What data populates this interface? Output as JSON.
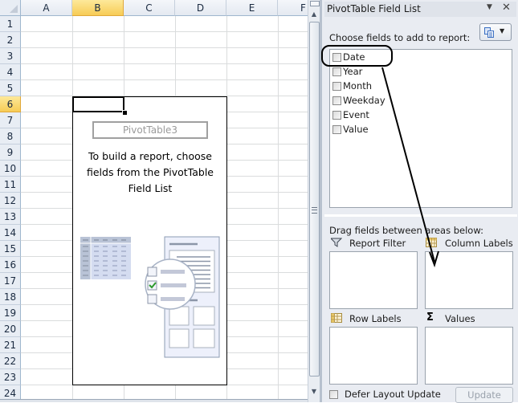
{
  "spreadsheet": {
    "columns": [
      "A",
      "B",
      "C",
      "D",
      "E",
      "F"
    ],
    "selected_column": "B",
    "rows": [
      "1",
      "2",
      "3",
      "4",
      "5",
      "6",
      "7",
      "8",
      "9",
      "10",
      "11",
      "12",
      "13",
      "14",
      "15",
      "16",
      "17",
      "18",
      "19",
      "20",
      "21",
      "22",
      "23",
      "24"
    ],
    "selected_row": "6",
    "active_cell": "B6",
    "pivot_placeholder": {
      "name": "PivotTable3",
      "message": "To build a report, choose fields from the PivotTable Field List"
    }
  },
  "pane": {
    "title": "PivotTable Field List",
    "menu_icon": "dropdown-arrow",
    "close_icon": "close-x",
    "choose_label": "Choose fields to add to report:",
    "fields": [
      {
        "label": "Date",
        "checked": false
      },
      {
        "label": "Year",
        "checked": false
      },
      {
        "label": "Month",
        "checked": false
      },
      {
        "label": "Weekday",
        "checked": false
      },
      {
        "label": "Event",
        "checked": false
      },
      {
        "label": "Value",
        "checked": false
      }
    ],
    "drag_label": "Drag fields between areas below:",
    "areas": {
      "report_filter": "Report Filter",
      "column_labels": "Column Labels",
      "row_labels": "Row Labels",
      "values": "Values"
    },
    "defer_label": "Defer Layout Update",
    "defer_checked": false,
    "update_label": "Update"
  },
  "annotation": {
    "highlighted_field": "Date",
    "arrow_target": "Column Labels",
    "color": "#000000"
  }
}
